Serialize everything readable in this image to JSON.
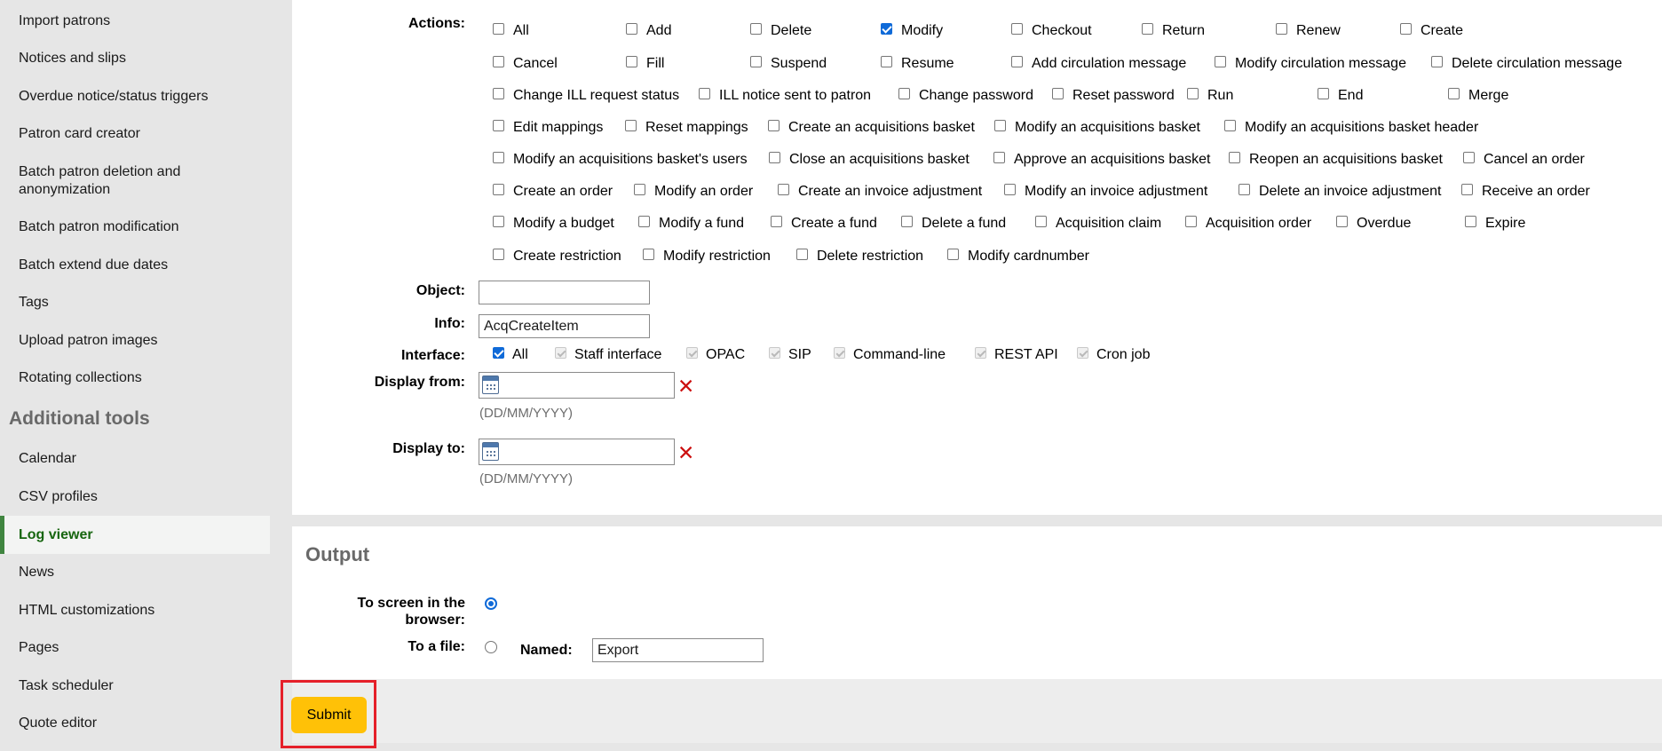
{
  "sidebar": {
    "items_top": [
      "Import patrons",
      "Notices and slips",
      "Overdue notice/status triggers",
      "Patron card creator",
      "Batch patron deletion and anonymization",
      "Batch patron modification",
      "Batch extend due dates",
      "Tags",
      "Upload patron images",
      "Rotating collections"
    ],
    "heading": "Additional tools",
    "items_bottom": [
      "Calendar",
      "CSV profiles",
      "Log viewer",
      "News",
      "HTML customizations",
      "Pages",
      "Task scheduler",
      "Quote editor"
    ],
    "active_item": "Log viewer"
  },
  "form": {
    "actions_label": "Actions:",
    "actions": [
      {
        "label": "All",
        "checked": false
      },
      {
        "label": "Add",
        "checked": false
      },
      {
        "label": "Delete",
        "checked": false
      },
      {
        "label": "Modify",
        "checked": true
      },
      {
        "label": "Checkout",
        "checked": false
      },
      {
        "label": "Return",
        "checked": false
      },
      {
        "label": "Renew",
        "checked": false
      },
      {
        "label": "Create",
        "checked": false
      },
      {
        "label": "Cancel",
        "checked": false
      },
      {
        "label": "Fill",
        "checked": false
      },
      {
        "label": "Suspend",
        "checked": false
      },
      {
        "label": "Resume",
        "checked": false
      },
      {
        "label": "Add circulation message",
        "checked": false
      },
      {
        "label": "Modify circulation message",
        "checked": false
      },
      {
        "label": "Delete circulation message",
        "checked": false
      },
      {
        "label": "Change ILL request status",
        "checked": false
      },
      {
        "label": "ILL notice sent to patron",
        "checked": false
      },
      {
        "label": "Change password",
        "checked": false
      },
      {
        "label": "Reset password",
        "checked": false
      },
      {
        "label": "Run",
        "checked": false
      },
      {
        "label": "End",
        "checked": false
      },
      {
        "label": "Merge",
        "checked": false
      },
      {
        "label": "Edit mappings",
        "checked": false
      },
      {
        "label": "Reset mappings",
        "checked": false
      },
      {
        "label": "Create an acquisitions basket",
        "checked": false
      },
      {
        "label": "Modify an acquisitions basket",
        "checked": false
      },
      {
        "label": "Modify an acquisitions basket header",
        "checked": false
      },
      {
        "label": "Modify an acquisitions basket's users",
        "checked": false
      },
      {
        "label": "Close an acquisitions basket",
        "checked": false
      },
      {
        "label": "Approve an acquisitions basket",
        "checked": false
      },
      {
        "label": "Reopen an acquisitions basket",
        "checked": false
      },
      {
        "label": "Cancel an order",
        "checked": false
      },
      {
        "label": "Create an order",
        "checked": false
      },
      {
        "label": "Modify an order",
        "checked": false
      },
      {
        "label": "Create an invoice adjustment",
        "checked": false
      },
      {
        "label": "Modify an invoice adjustment",
        "checked": false
      },
      {
        "label": "Delete an invoice adjustment",
        "checked": false
      },
      {
        "label": "Receive an order",
        "checked": false
      },
      {
        "label": "Modify a budget",
        "checked": false
      },
      {
        "label": "Modify a fund",
        "checked": false
      },
      {
        "label": "Create a fund",
        "checked": false
      },
      {
        "label": "Delete a fund",
        "checked": false
      },
      {
        "label": "Acquisition claim",
        "checked": false
      },
      {
        "label": "Acquisition order",
        "checked": false
      },
      {
        "label": "Overdue",
        "checked": false
      },
      {
        "label": "Expire",
        "checked": false
      },
      {
        "label": "Create restriction",
        "checked": false
      },
      {
        "label": "Modify restriction",
        "checked": false
      },
      {
        "label": "Delete restriction",
        "checked": false
      },
      {
        "label": "Modify cardnumber",
        "checked": false
      }
    ],
    "object_label": "Object:",
    "object_value": "",
    "info_label": "Info:",
    "info_value": "AcqCreateItem",
    "interface_label": "Interface:",
    "interfaces": [
      {
        "label": "All",
        "checked": true,
        "disabled": false
      },
      {
        "label": "Staff interface",
        "checked": true,
        "disabled": true
      },
      {
        "label": "OPAC",
        "checked": true,
        "disabled": true
      },
      {
        "label": "SIP",
        "checked": true,
        "disabled": true
      },
      {
        "label": "Command-line",
        "checked": true,
        "disabled": true
      },
      {
        "label": "REST API",
        "checked": true,
        "disabled": true
      },
      {
        "label": "Cron job",
        "checked": true,
        "disabled": true
      }
    ],
    "display_from_label": "Display from:",
    "display_to_label": "Display to:",
    "date_hint": "(DD/MM/YYYY)",
    "clear_symbol": "✕"
  },
  "output": {
    "title": "Output",
    "to_screen_label_1": "To screen in the",
    "to_screen_label_2": "browser:",
    "to_screen_selected": true,
    "to_file_label": "To a file:",
    "named_label": "Named:",
    "named_value": "Export"
  },
  "submit_label": "Submit",
  "colors": {
    "active_nav": "#16650f",
    "submit": "#ffc107",
    "highlight": "#e5202a",
    "checkbox_checked": "#0f6ad8"
  }
}
